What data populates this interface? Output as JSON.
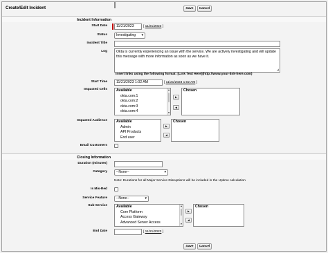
{
  "page_title": "Create/Edit Incident",
  "buttons": {
    "save": "Save",
    "cancel": "Cancel"
  },
  "sections": {
    "incident": "Incident Information",
    "closing": "Closing Information"
  },
  "fields": {
    "start_date": {
      "label": "Start Date",
      "value": "11/21/2023",
      "today_link": "11/21/2023"
    },
    "status": {
      "label": "Status",
      "value": "Investigating"
    },
    "incident_title": {
      "label": "Incident Title",
      "value": ""
    },
    "log": {
      "label": "Log",
      "value": "Okta is currently experiencing an issue with the service. We are actively investigating and will update this message with more information as soon as we have it.",
      "hint": "Insert links using the following format: [Link Text Here](http://www.your-link-here.com)"
    },
    "start_time": {
      "label": "Start Time",
      "value": "11/21/2023 1:02 AM",
      "now_link": "11/21/2023 1:02 AM"
    },
    "impacted_cells": {
      "label": "Impacted Cells",
      "available_header": "Available",
      "available": [
        "okta.com:1",
        "okta.com:2",
        "okta.com:3",
        "okta.com:4"
      ],
      "chosen_header": "Chosen"
    },
    "impacted_audience": {
      "label": "Impacted Audience",
      "available_header": "Available",
      "available": [
        "Admin",
        "API Products",
        "End user"
      ],
      "chosen_header": "Chosen"
    },
    "email_customers": {
      "label": "Email Customers"
    },
    "duration": {
      "label": "Duration (minutes)",
      "value": ""
    },
    "category": {
      "label": "Category",
      "value": "--None--",
      "note": "Note: Durations for all Major Service Disruptions will be included in the Uptime calculation"
    },
    "is_mis_red": {
      "label": "Is Mis-Red"
    },
    "service_feature": {
      "label": "Service Feature",
      "value": "--None--"
    },
    "sub_service": {
      "label": "Sub-Service",
      "available_header": "Available",
      "available": [
        "Core Platform",
        "Access Gateway",
        "Advanced Server Access"
      ],
      "chosen_header": "Chosen"
    },
    "end_date": {
      "label": "End Date",
      "value": "",
      "today_link": "11/21/2023"
    }
  },
  "icons": {
    "add_arrow": "►",
    "remove_arrow": "◄",
    "caret": "▾",
    "scroll_up": "▲",
    "scroll_down": "▼"
  },
  "colors": {
    "required": "#c00000",
    "background": "#f3f3f3"
  }
}
